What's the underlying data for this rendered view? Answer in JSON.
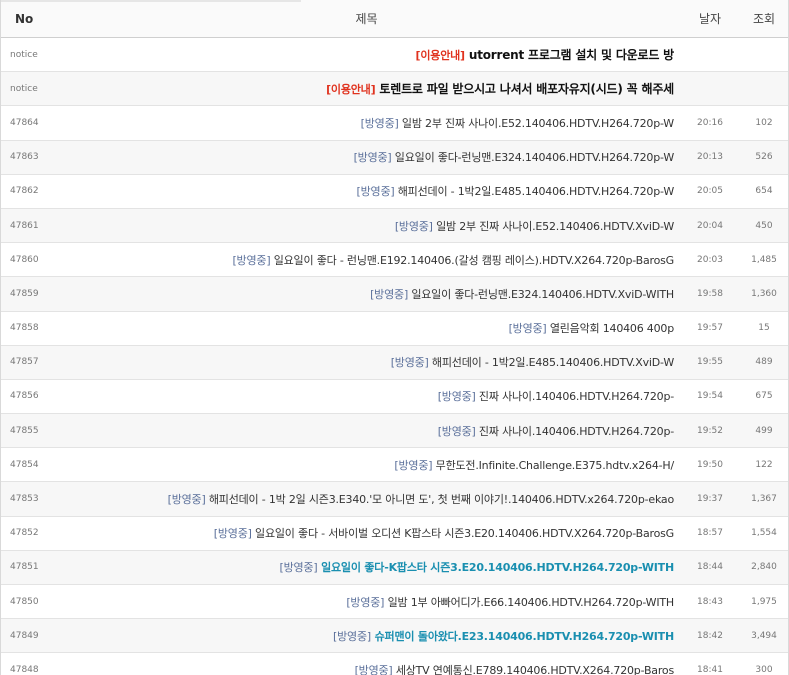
{
  "header": {
    "no": "No",
    "title": "제목",
    "date": "날자",
    "views": "조회"
  },
  "rows": [
    {
      "no": "notice",
      "cat": "[이용안내]",
      "title": " utorrent 프로그램 설치 및 다운로드 방",
      "date": "",
      "views": ""
    },
    {
      "no": "notice",
      "cat": "[이용안내]",
      "title": " 토렌트로 파일 받으시고 나셔서 배포자유지(시드) 꼭 해주세",
      "date": "",
      "views": ""
    },
    {
      "no": "47864",
      "cat": "[방영중]",
      "title": " 일밤 2부 진짜 사나이.E52.140406.HDTV.H264.720p-W",
      "date": "20:16",
      "views": "102"
    },
    {
      "no": "47863",
      "cat": "[방영중]",
      "title": " 일요일이 좋다-런닝맨.E324.140406.HDTV.H264.720p-W",
      "date": "20:13",
      "views": "526"
    },
    {
      "no": "47862",
      "cat": "[방영중]",
      "title": " 해피선데이 - 1박2일.E485.140406.HDTV.H264.720p-W",
      "date": "20:05",
      "views": "654"
    },
    {
      "no": "47861",
      "cat": "[방영중]",
      "title": " 일밤 2부 진짜 사나이.E52.140406.HDTV.XviD-W",
      "date": "20:04",
      "views": "450"
    },
    {
      "no": "47860",
      "cat": "[방영중]",
      "title": " 일요일이 좋다 - 런닝맨.E192.140406.(갈성 캠핑 레이스).HDTV.X264.720p-BarosG",
      "date": "20:03",
      "views": "1,485"
    },
    {
      "no": "47859",
      "cat": "[방영중]",
      "title": " 일요일이 좋다-런닝맨.E324.140406.HDTV.XviD-WITH",
      "date": "19:58",
      "views": "1,360"
    },
    {
      "no": "47858",
      "cat": "[방영중]",
      "title": " 열린음악회 140406 400p",
      "date": "19:57",
      "views": "15"
    },
    {
      "no": "47857",
      "cat": "[방영중]",
      "title": " 해피선데이 - 1박2일.E485.140406.HDTV.XviD-W",
      "date": "19:55",
      "views": "489"
    },
    {
      "no": "47856",
      "cat": "[방영중]",
      "title": " 진짜 사나이.140406.HDTV.H264.720p-",
      "date": "19:54",
      "views": "675"
    },
    {
      "no": "47855",
      "cat": "[방영중]",
      "title": " 진짜 사나이.140406.HDTV.H264.720p-",
      "date": "19:52",
      "views": "499"
    },
    {
      "no": "47854",
      "cat": "[방영중]",
      "title": " 무한도전.Infinite.Challenge.E375.hdtv.x264-H/",
      "date": "19:50",
      "views": "122"
    },
    {
      "no": "47853",
      "cat": "[방영중]",
      "title": " 해피선데이 - 1박 2일 시즌3.E340.'모 아니면 도', 첫 번째 이야기!.140406.HDTV.x264.720p-ekao",
      "date": "19:37",
      "views": "1,367"
    },
    {
      "no": "47852",
      "cat": "[방영중]",
      "title": " 일요일이 좋다 - 서바이벌 오디션 K팝스타 시즌3.E20.140406.HDTV.X264.720p-BarosG",
      "date": "18:57",
      "views": "1,554"
    },
    {
      "no": "47851",
      "cat": "[방영중]",
      "title": " 일요일이 좋다-K팝스타 시즌3.E20.140406.HDTV.H264.720p-WITH",
      "date": "18:44",
      "views": "2,840"
    },
    {
      "no": "47850",
      "cat": "[방영중]",
      "title": " 일밤 1부 아빠어디가.E66.140406.HDTV.H264.720p-WITH",
      "date": "18:43",
      "views": "1,975"
    },
    {
      "no": "47849",
      "cat": "[방영중]",
      "title": " 슈퍼맨이 돌아왔다.E23.140406.HDTV.H264.720p-WITH",
      "date": "18:42",
      "views": "3,494"
    },
    {
      "no": "47848",
      "cat": "[방영중]",
      "title": " 세상TV 연예통신.E789.140406.HDTV.X264.720p-Baros",
      "date": "18:41",
      "views": "300"
    }
  ],
  "styles": {
    "notice_rows": [
      0,
      1
    ],
    "highlight_rows": [
      15,
      17
    ],
    "alt_rows": [
      1,
      3,
      5,
      7,
      9,
      11,
      13,
      15,
      17
    ]
  }
}
